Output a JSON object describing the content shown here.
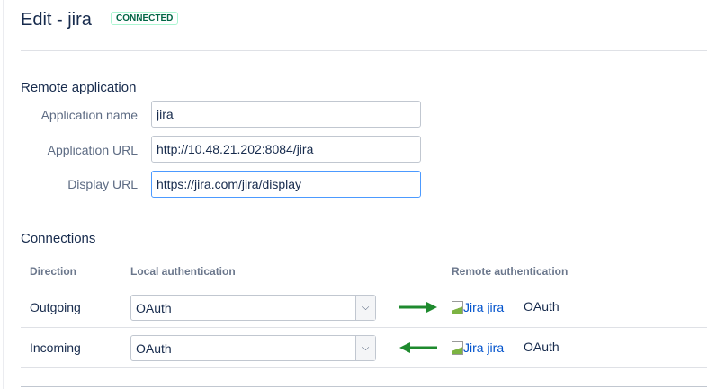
{
  "header": {
    "title": "Edit - jira",
    "status_badge": "CONNECTED"
  },
  "remote_application": {
    "heading": "Remote application",
    "fields": [
      {
        "label": "Application name",
        "value": "jira"
      },
      {
        "label": "Application URL",
        "value": "http://10.48.21.202:8084/jira"
      },
      {
        "label": "Display URL",
        "value": "https://jira.com/jira/display"
      }
    ]
  },
  "connections": {
    "heading": "Connections",
    "columns": [
      "Direction",
      "Local authentication",
      "Remote authentication"
    ],
    "rows": [
      {
        "direction": "Outgoing",
        "local_auth": "OAuth",
        "remote_image_alt": "Jira jira",
        "remote_auth": "OAuth",
        "arrow": "right"
      },
      {
        "direction": "Incoming",
        "local_auth": "OAuth",
        "remote_image_alt": "Jira jira",
        "remote_auth": "OAuth",
        "arrow": "left"
      }
    ]
  },
  "colors": {
    "arrow": "#1e8a2e",
    "badge_text": "#006644"
  }
}
